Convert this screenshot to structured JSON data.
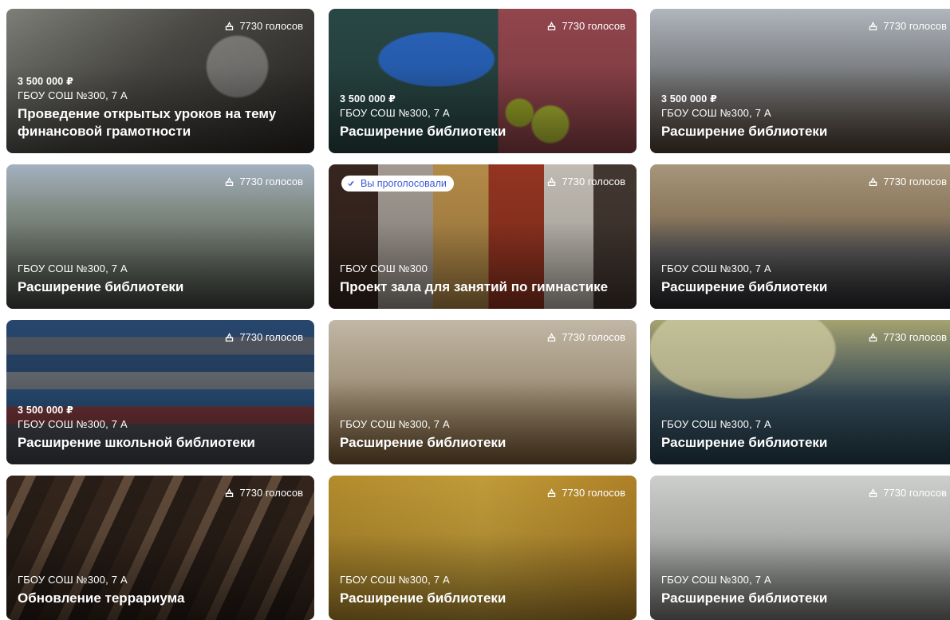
{
  "vote_label_suffix": "голосов",
  "voted_badge_text": "Вы проголосовали",
  "cards": [
    {
      "votes": "7730 голосов",
      "amount": "3 500 000 ₽",
      "school": "ГБОУ СОШ №300, 7 А",
      "title": "Проведение открытых уроков на тему финансовой грамотности"
    },
    {
      "votes": "7730 голосов",
      "amount": "3 500 000 ₽",
      "school": "ГБОУ СОШ №300, 7 А",
      "title": "Расширение библиотеки"
    },
    {
      "votes": "7730 голосов",
      "amount": "3 500 000 ₽",
      "school": "ГБОУ СОШ №300, 7 А",
      "title": "Расширение библиотеки"
    },
    {
      "votes": "7730 голосов",
      "school": "ГБОУ СОШ №300, 7 А",
      "title": "Расширение библиотеки"
    },
    {
      "votes": "7730 голосов",
      "badge": "Вы проголосовали",
      "school": "ГБОУ СОШ №300",
      "title": "Проект зала для занятий по гимнастике"
    },
    {
      "votes": "7730 голосов",
      "school": "ГБОУ СОШ №300, 7 А",
      "title": "Расширение библиотеки"
    },
    {
      "votes": "7730 голосов",
      "amount": "3 500 000 ₽",
      "school": "ГБОУ СОШ №300, 7 А",
      "title": "Расширение школьной библиотеки"
    },
    {
      "votes": "7730 голосов",
      "school": "ГБОУ СОШ №300, 7 А",
      "title": "Расширение библиотеки"
    },
    {
      "votes": "7730 голосов",
      "school": "ГБОУ СОШ №300, 7 А",
      "title": "Расширение библиотеки"
    },
    {
      "votes": "7730 голосов",
      "school": "ГБОУ СОШ №300, 7 А",
      "title": "Обновление террариума"
    },
    {
      "votes": "7730 голосов",
      "school": "ГБОУ СОШ №300, 7 А",
      "title": "Расширение библиотеки"
    },
    {
      "votes": "7730 голосов",
      "school": "ГБОУ СОШ №300, 7 А",
      "title": "Расширение библиотеки"
    }
  ]
}
